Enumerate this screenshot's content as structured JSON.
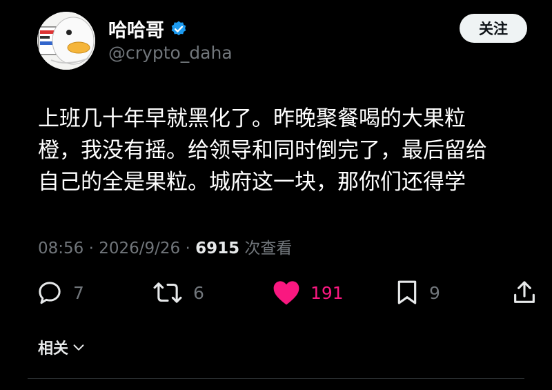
{
  "author": {
    "display_name": "哈哈哥",
    "handle": "@crypto_daha",
    "avatar_icon": "duck-avatar-icon",
    "verified_icon": "verified-badge-icon",
    "verified_color": "#1d9bf0"
  },
  "follow_label": "关注",
  "tweet": {
    "lines": [
      "上班几十年早就黑化了。昨晚聚餐喝的大果粒",
      "橙，我没有摇。给领导和同时倒完了，最后留给",
      "自己的全是果粒。城府这一块，那你们还得学"
    ]
  },
  "meta": {
    "time": "08:56",
    "sep1": " · ",
    "date": "2026/9/26",
    "sep2": " · ",
    "views": "6915",
    "views_label": " 次查看"
  },
  "actions": {
    "reply": {
      "icon": "reply-icon",
      "count": "7"
    },
    "repost": {
      "icon": "repost-icon",
      "count": "6"
    },
    "like": {
      "icon": "heart-icon",
      "count": "191",
      "color": "#f91880"
    },
    "bookmark": {
      "icon": "bookmark-icon",
      "count": "9"
    },
    "share": {
      "icon": "share-icon"
    }
  },
  "related_label": "相关"
}
